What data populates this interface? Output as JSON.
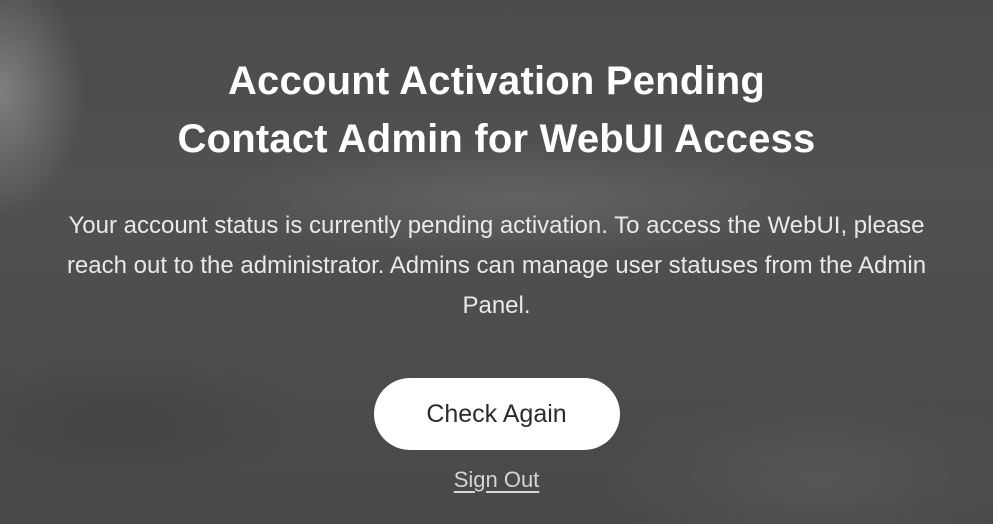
{
  "screen": {
    "title_line1": "Account Activation Pending",
    "title_line2": "Contact Admin for WebUI Access",
    "message": "Your account status is currently pending activation. To access the WebUI, please reach out to the administrator. Admins can manage user statuses from the Admin Panel."
  },
  "actions": {
    "check_again_label": "Check Again",
    "sign_out_label": "Sign Out"
  },
  "colors": {
    "background": "#4a4a4a",
    "button_bg": "#ffffff",
    "button_text": "#2b2b2b",
    "link_text": "#d4d4d4"
  }
}
